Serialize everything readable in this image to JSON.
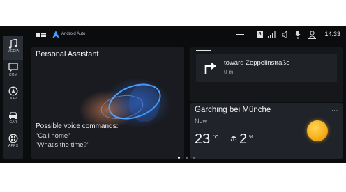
{
  "status_bar": {
    "app_label": "Android Auto",
    "signal_badge": "5",
    "clock": "14:33"
  },
  "rail": {
    "items": [
      {
        "label": "MEDIA",
        "icon": "music-note-icon",
        "active": true
      },
      {
        "label": "COM",
        "icon": "chat-icon",
        "active": false
      },
      {
        "label": "NAV",
        "icon": "navigation-icon",
        "active": false
      },
      {
        "label": "CAR",
        "icon": "car-icon",
        "active": false
      },
      {
        "label": "APPS",
        "icon": "apps-icon",
        "active": false
      }
    ]
  },
  "assistant": {
    "title": "Personal Assistant",
    "commands_heading": "Possible voice commands:",
    "commands": [
      "\"Call home\"",
      "\"What's the time?\""
    ]
  },
  "navigation": {
    "street": "toward Zeppelinstraße",
    "distance": "0 m"
  },
  "weather": {
    "city": "Garching bei Münche",
    "when": "Now",
    "temperature": "23",
    "temperature_unit": "°C",
    "precipitation": "2",
    "precipitation_unit": "%",
    "menu": "..."
  },
  "colors": {
    "screen_bg": "#0b0c0e",
    "tile_bg": "#1b1d21",
    "accent_blue": "#2f8cff",
    "sun": "#f7b21b"
  }
}
